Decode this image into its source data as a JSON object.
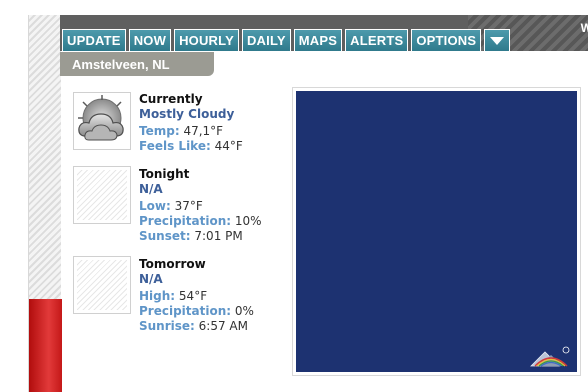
{
  "top_band": {
    "edge_text": "W"
  },
  "nav": {
    "buttons": [
      "UPDATE",
      "NOW",
      "HOURLY",
      "DAILY",
      "MAPS",
      "ALERTS",
      "OPTIONS"
    ]
  },
  "location": "Amstelveen, NL",
  "currently": {
    "heading": "Currently",
    "condition": "Mostly Cloudy",
    "temp_label": "Temp:",
    "temp_value": "47,1°F",
    "feels_label": "Feels Like:",
    "feels_value": "44°F",
    "icon": "mostly-cloudy-icon"
  },
  "tonight": {
    "heading": "Tonight",
    "condition": "N/A",
    "low_label": "Low:",
    "low_value": "37°F",
    "precip_label": "Precipitation:",
    "precip_value": "10%",
    "sunset_label": "Sunset:",
    "sunset_value": "7:01 PM"
  },
  "tomorrow": {
    "heading": "Tomorrow",
    "condition": "N/A",
    "high_label": "High:",
    "high_value": "54°F",
    "precip_label": "Precipitation:",
    "precip_value": "0%",
    "sunrise_label": "Sunrise:",
    "sunrise_value": "6:57 AM"
  },
  "colors": {
    "nav_button": "#3a8799",
    "radar_background": "#1d3271",
    "label": "#5f95c8",
    "condition": "#3d5f99",
    "red_bar": "#cc1f1f"
  }
}
